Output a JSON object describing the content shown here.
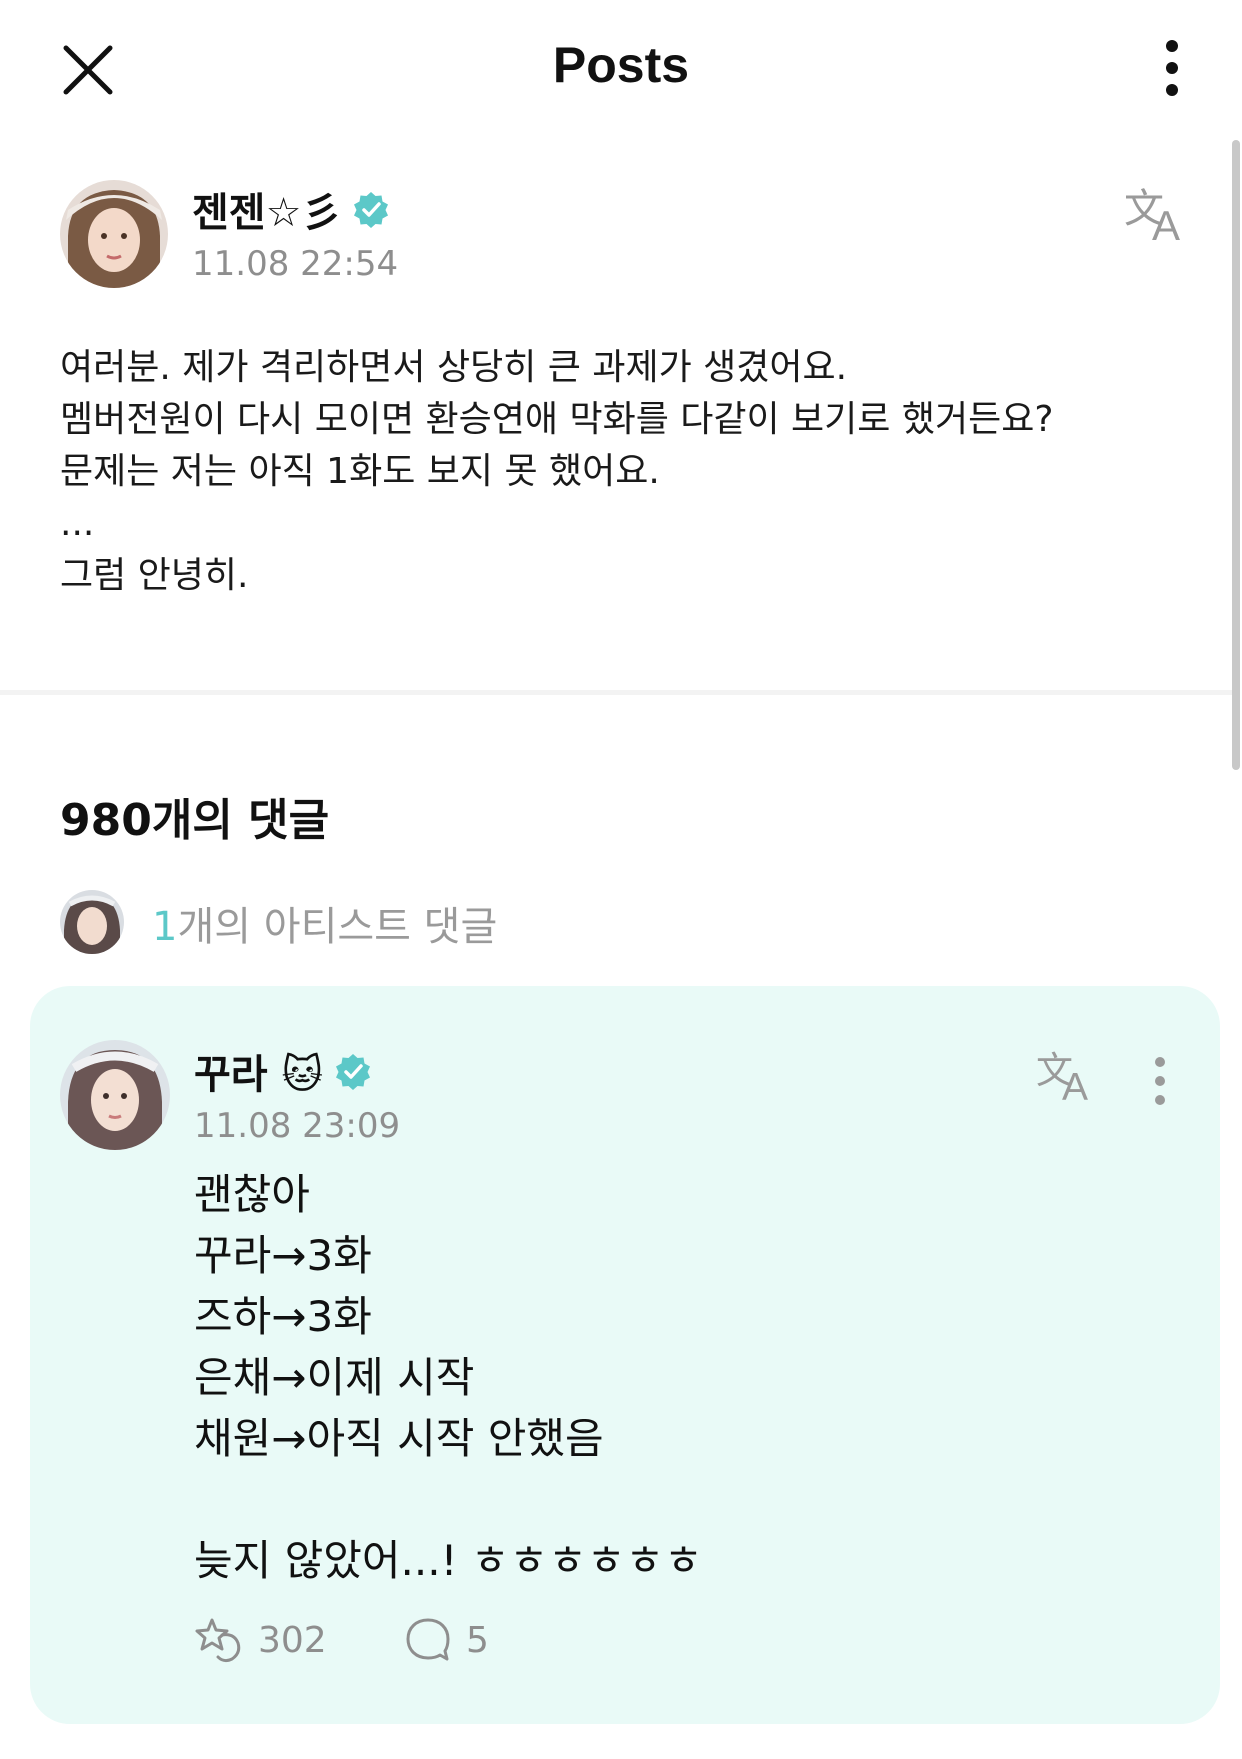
{
  "header": {
    "title": "Posts",
    "close_icon": "close-icon",
    "more_icon": "more-vertical-icon"
  },
  "post": {
    "author": "젠젠☆彡",
    "verified": true,
    "timestamp": "11.08 22:54",
    "lines": [
      "여러분. 제가 격리하면서 상당히 큰 과제가 생겼어요.",
      "멤버전원이 다시 모이면 환승연애 막화를 다같이 보기로 했거든요?",
      "문제는 저는 아직 1화도 보지 못 했어요.",
      "...",
      "그럼 안녕히."
    ]
  },
  "comments": {
    "count_label": "980개의 댓글",
    "artist_comments": {
      "count": "1",
      "label": "개의 아티스트 댓글"
    }
  },
  "comment": {
    "author": "꾸라 🐱",
    "verified": true,
    "timestamp": "11.08 23:09",
    "lines": [
      "괜찮아",
      "꾸라→3화",
      "즈하→3화",
      "은채→이제 시작",
      "채원→아직 시작 안했음",
      "",
      "늦지 않았어...! ㅎㅎㅎㅎㅎㅎ"
    ],
    "likes": "302",
    "replies": "5"
  },
  "colors": {
    "accent": "#5cc8c8",
    "card_bg": "#e9faf7",
    "muted": "#8e8e8e"
  }
}
